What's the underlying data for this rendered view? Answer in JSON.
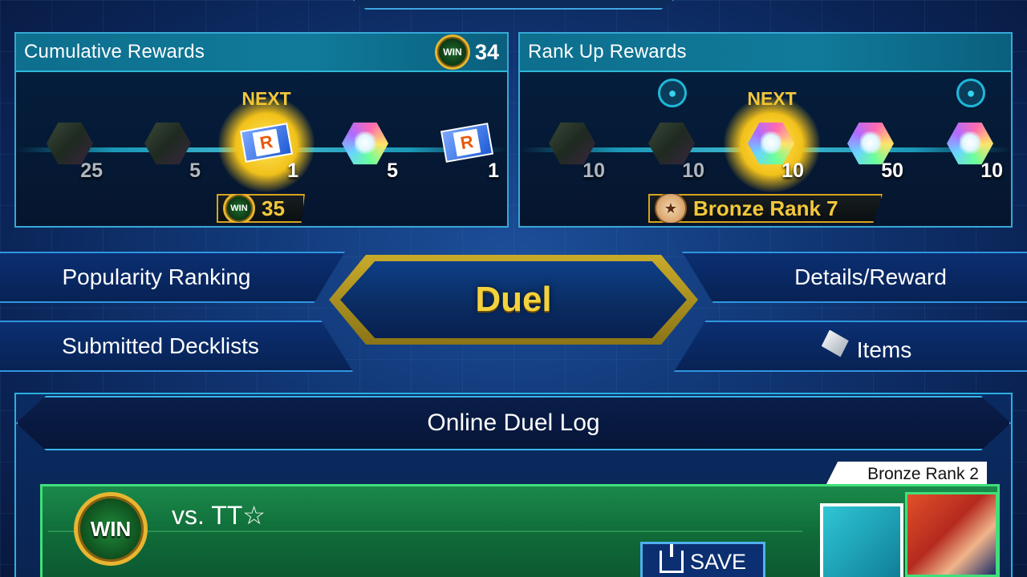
{
  "cumulative": {
    "title": "Cumulative Rewards",
    "win_count": "34",
    "next_label": "NEXT",
    "rewards": [
      {
        "type": "dark-gem",
        "count": "25"
      },
      {
        "type": "dark-gem",
        "count": "5"
      },
      {
        "type": "rental-ticket",
        "count": "1"
      },
      {
        "type": "rainbow-gem",
        "count": "5"
      },
      {
        "type": "rental-ticket",
        "count": "1"
      }
    ],
    "next_win_target": "35",
    "win_badge_text": "WIN"
  },
  "rank_up": {
    "title": "Rank Up Rewards",
    "next_label": "NEXT",
    "rewards": [
      {
        "type": "dark-gem",
        "count": "10"
      },
      {
        "type": "dark-gem",
        "count": "10"
      },
      {
        "type": "rainbow-gem",
        "count": "10"
      },
      {
        "type": "rainbow-gem",
        "count": "50"
      },
      {
        "type": "rainbow-gem",
        "count": "10"
      }
    ],
    "next_rank": "Bronze Rank 7"
  },
  "menu": {
    "popularity_ranking": "Popularity Ranking",
    "submitted_decklists": "Submitted Decklists",
    "details_reward": "Details/Reward",
    "items": "Items",
    "duel": "Duel"
  },
  "log": {
    "title": "Online Duel Log",
    "entry": {
      "result": "WIN",
      "opponent": "vs. TT☆",
      "opponent_rank": "Bronze Rank 2",
      "save_label": "SAVE"
    }
  },
  "colors": {
    "gold": "#f2c83a",
    "teal_header": "#117a9a",
    "win_green": "#1a8a4a",
    "panel_border": "#38a8d8"
  }
}
